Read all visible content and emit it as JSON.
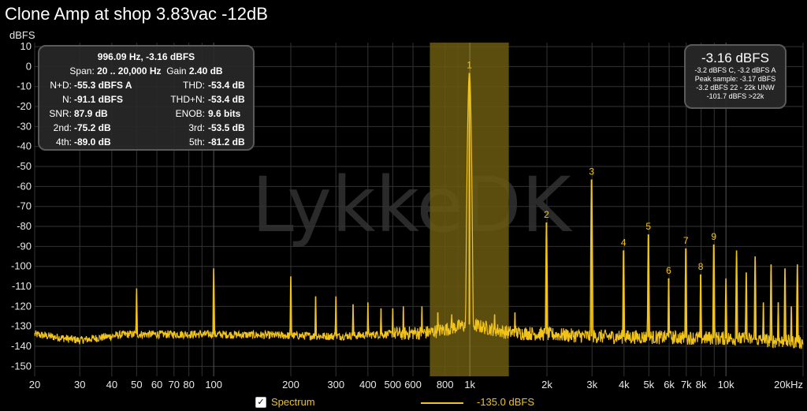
{
  "title": "Clone Amp at shop 3.83vac -12dB",
  "watermark": "LykkeDK",
  "colors": {
    "trace": "#f2c418",
    "highlight": "#6b5a10",
    "grid": "#333333",
    "background": "#000000"
  },
  "stats_panel": {
    "header_line1": "996.09 Hz, -3.16 dBFS",
    "span_label": "Span:",
    "span_value": "20 .. 20,000 Hz",
    "gain_label": "Gain",
    "gain_value": "2.40 dB",
    "rows": [
      {
        "l1": "N+D:",
        "v1": "-55.3 dBFS A",
        "l2": "THD:",
        "v2": "-53.4 dB"
      },
      {
        "l1": "N:",
        "v1": "-91.1 dBFS",
        "l2": "THD+N:",
        "v2": "-53.4 dB"
      },
      {
        "l1": "SNR:",
        "v1": "87.9 dB",
        "l2": "ENOB:",
        "v2": "9.6 bits"
      },
      {
        "l1": "2nd:",
        "v1": "-75.2 dB",
        "l2": "3rd:",
        "v2": "-53.5 dB"
      },
      {
        "l1": "4th:",
        "v1": "-89.0 dB",
        "l2": "5th:",
        "v2": "-81.2 dB"
      }
    ]
  },
  "level_panel": {
    "main": "-3.16 dBFS",
    "lines": [
      "-3.2 dBFS C, -3.2 dBFS A",
      "Peak sample: -3.17 dBFS",
      "-3.2 dBFS 22 - 22k UNW",
      "-101.7 dBFS >22k"
    ]
  },
  "legend": {
    "checked": true,
    "label": "Spectrum",
    "value": "-135.0 dBFS"
  },
  "chart_data": {
    "type": "line",
    "xscale": "log",
    "xlim": [
      20,
      20000
    ],
    "ylim": [
      -155,
      12
    ],
    "ylabel": "dBFS",
    "y_ticks": [
      10,
      0,
      -10,
      -20,
      -30,
      -40,
      -50,
      -60,
      -70,
      -80,
      -90,
      -100,
      -110,
      -120,
      -130,
      -140,
      -150
    ],
    "x_ticks": [
      {
        "v": 20,
        "t": "20"
      },
      {
        "v": 30,
        "t": "30"
      },
      {
        "v": 40,
        "t": "40"
      },
      {
        "v": 50,
        "t": "50"
      },
      {
        "v": 60,
        "t": "60"
      },
      {
        "v": 70,
        "t": "70"
      },
      {
        "v": 80,
        "t": "80"
      },
      {
        "v": 100,
        "t": "100"
      },
      {
        "v": 200,
        "t": "200"
      },
      {
        "v": 300,
        "t": "300"
      },
      {
        "v": 400,
        "t": "400"
      },
      {
        "v": 500,
        "t": "500"
      },
      {
        "v": 600,
        "t": "600"
      },
      {
        "v": 800,
        "t": "800"
      },
      {
        "v": 1000,
        "t": "1k"
      },
      {
        "v": 2000,
        "t": "2k"
      },
      {
        "v": 3000,
        "t": "3k"
      },
      {
        "v": 4000,
        "t": "4k"
      },
      {
        "v": 5000,
        "t": "5k"
      },
      {
        "v": 6000,
        "t": "6k"
      },
      {
        "v": 7000,
        "t": "7k"
      },
      {
        "v": 8000,
        "t": "8k"
      },
      {
        "v": 10000,
        "t": "10k"
      },
      {
        "v": 20000,
        "t": "20kHz"
      }
    ],
    "highlight_band": [
      700,
      1420
    ],
    "harmonics": [
      {
        "label": "1",
        "f": 996,
        "db": -3.2
      },
      {
        "label": "2",
        "f": 1992,
        "db": -78
      },
      {
        "label": "3",
        "f": 2988,
        "db": -56.5
      },
      {
        "label": "4",
        "f": 3984,
        "db": -92
      },
      {
        "label": "5",
        "f": 4980,
        "db": -84
      },
      {
        "label": "6",
        "f": 5976,
        "db": -106
      },
      {
        "label": "7",
        "f": 6972,
        "db": -91
      },
      {
        "label": "8",
        "f": 7968,
        "db": -104
      },
      {
        "label": "9",
        "f": 8964,
        "db": -89
      }
    ],
    "spurs": [
      {
        "f": 50,
        "db": -111
      },
      {
        "f": 100,
        "db": -101
      },
      {
        "f": 200,
        "db": -105
      },
      {
        "f": 250,
        "db": -115
      },
      {
        "f": 300,
        "db": -115
      },
      {
        "f": 350,
        "db": -119
      },
      {
        "f": 400,
        "db": -118
      },
      {
        "f": 450,
        "db": -121
      },
      {
        "f": 500,
        "db": -121
      },
      {
        "f": 550,
        "db": -120
      },
      {
        "f": 650,
        "db": -120
      },
      {
        "f": 750,
        "db": -123
      },
      {
        "f": 850,
        "db": -124
      },
      {
        "f": 1250,
        "db": -124
      },
      {
        "f": 1500,
        "db": -123
      },
      {
        "f": 10000,
        "db": -106
      },
      {
        "f": 11000,
        "db": -92
      },
      {
        "f": 12000,
        "db": -103
      },
      {
        "f": 13000,
        "db": -95
      },
      {
        "f": 14000,
        "db": -118
      },
      {
        "f": 15000,
        "db": -99
      },
      {
        "f": 16000,
        "db": -118
      },
      {
        "f": 17000,
        "db": -101
      },
      {
        "f": 18000,
        "db": -120
      },
      {
        "f": 19000,
        "db": -99
      }
    ],
    "noise_floor": [
      {
        "f": 20,
        "db": -134
      },
      {
        "f": 30,
        "db": -137
      },
      {
        "f": 45,
        "db": -134
      },
      {
        "f": 100,
        "db": -134
      },
      {
        "f": 300,
        "db": -135
      },
      {
        "f": 700,
        "db": -133
      },
      {
        "f": 1000,
        "db": -129
      },
      {
        "f": 1400,
        "db": -133
      },
      {
        "f": 3000,
        "db": -135
      },
      {
        "f": 10000,
        "db": -136
      },
      {
        "f": 20000,
        "db": -138
      }
    ]
  }
}
